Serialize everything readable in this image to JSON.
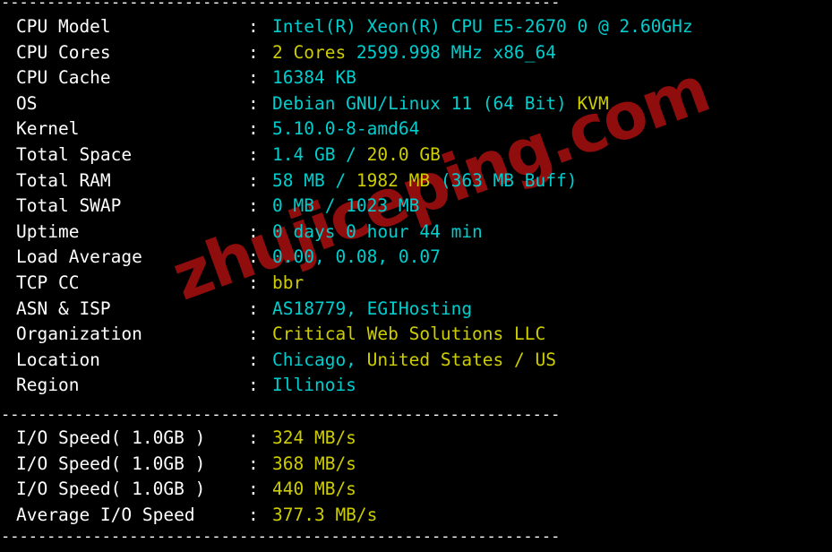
{
  "terminal": {
    "background": "#000000",
    "colors": {
      "cyan": "#00cdcd",
      "yellow": "#cdcd00",
      "white": "#ffffff",
      "watermark_red": "#8f0d0d"
    },
    "watermark": "zhujiceping.com",
    "separator": "-------------------------------------------------------------",
    "colon": ":"
  },
  "system_info": {
    "rows": [
      {
        "label": "CPU Model",
        "segments": [
          {
            "text": "Intel(R) Xeon(R) CPU E5-2670 0 @ 2.60GHz",
            "color": "cyan"
          }
        ]
      },
      {
        "label": "CPU Cores",
        "segments": [
          {
            "text": "2 Cores ",
            "color": "yellow"
          },
          {
            "text": "2599.998 MHz x86_64",
            "color": "cyan"
          }
        ]
      },
      {
        "label": "CPU Cache",
        "segments": [
          {
            "text": "16384 KB",
            "color": "cyan"
          }
        ]
      },
      {
        "label": "OS",
        "segments": [
          {
            "text": "Debian GNU/Linux 11 (64 Bit) ",
            "color": "cyan"
          },
          {
            "text": "KVM",
            "color": "yellow"
          }
        ]
      },
      {
        "label": "Kernel",
        "segments": [
          {
            "text": "5.10.0-8-amd64",
            "color": "cyan"
          }
        ]
      },
      {
        "label": "Total Space",
        "segments": [
          {
            "text": "1.4 GB / ",
            "color": "cyan"
          },
          {
            "text": "20.0 GB",
            "color": "yellow"
          }
        ]
      },
      {
        "label": "Total RAM",
        "segments": [
          {
            "text": "58 MB / ",
            "color": "cyan"
          },
          {
            "text": "1982 MB ",
            "color": "yellow"
          },
          {
            "text": "(363 MB Buff)",
            "color": "cyan"
          }
        ]
      },
      {
        "label": "Total SWAP",
        "segments": [
          {
            "text": "0 MB / 1023 MB",
            "color": "cyan"
          }
        ]
      },
      {
        "label": "Uptime",
        "segments": [
          {
            "text": "0 days 0 hour 44 min",
            "color": "cyan"
          }
        ]
      },
      {
        "label": "Load Average",
        "segments": [
          {
            "text": "0.00, 0.08, 0.07",
            "color": "cyan"
          }
        ]
      },
      {
        "label": "TCP CC",
        "segments": [
          {
            "text": "bbr",
            "color": "yellow"
          }
        ]
      },
      {
        "label": "ASN & ISP",
        "segments": [
          {
            "text": "AS18779, EGIHosting",
            "color": "cyan"
          }
        ]
      },
      {
        "label": "Organization",
        "segments": [
          {
            "text": "Critical Web Solutions LLC",
            "color": "yellow"
          }
        ]
      },
      {
        "label": "Location",
        "segments": [
          {
            "text": "Chicago, ",
            "color": "cyan"
          },
          {
            "text": "United States / US",
            "color": "yellow"
          }
        ]
      },
      {
        "label": "Region",
        "segments": [
          {
            "text": "Illinois",
            "color": "cyan"
          }
        ]
      }
    ]
  },
  "io_results": {
    "rows": [
      {
        "label": "I/O Speed( 1.0GB )",
        "segments": [
          {
            "text": "324 MB/s",
            "color": "yellow"
          }
        ]
      },
      {
        "label": "I/O Speed( 1.0GB )",
        "segments": [
          {
            "text": "368 MB/s",
            "color": "yellow"
          }
        ]
      },
      {
        "label": "I/O Speed( 1.0GB )",
        "segments": [
          {
            "text": "440 MB/s",
            "color": "yellow"
          }
        ]
      },
      {
        "label": "Average I/O Speed",
        "segments": [
          {
            "text": "377.3 MB/s",
            "color": "yellow"
          }
        ]
      }
    ]
  }
}
